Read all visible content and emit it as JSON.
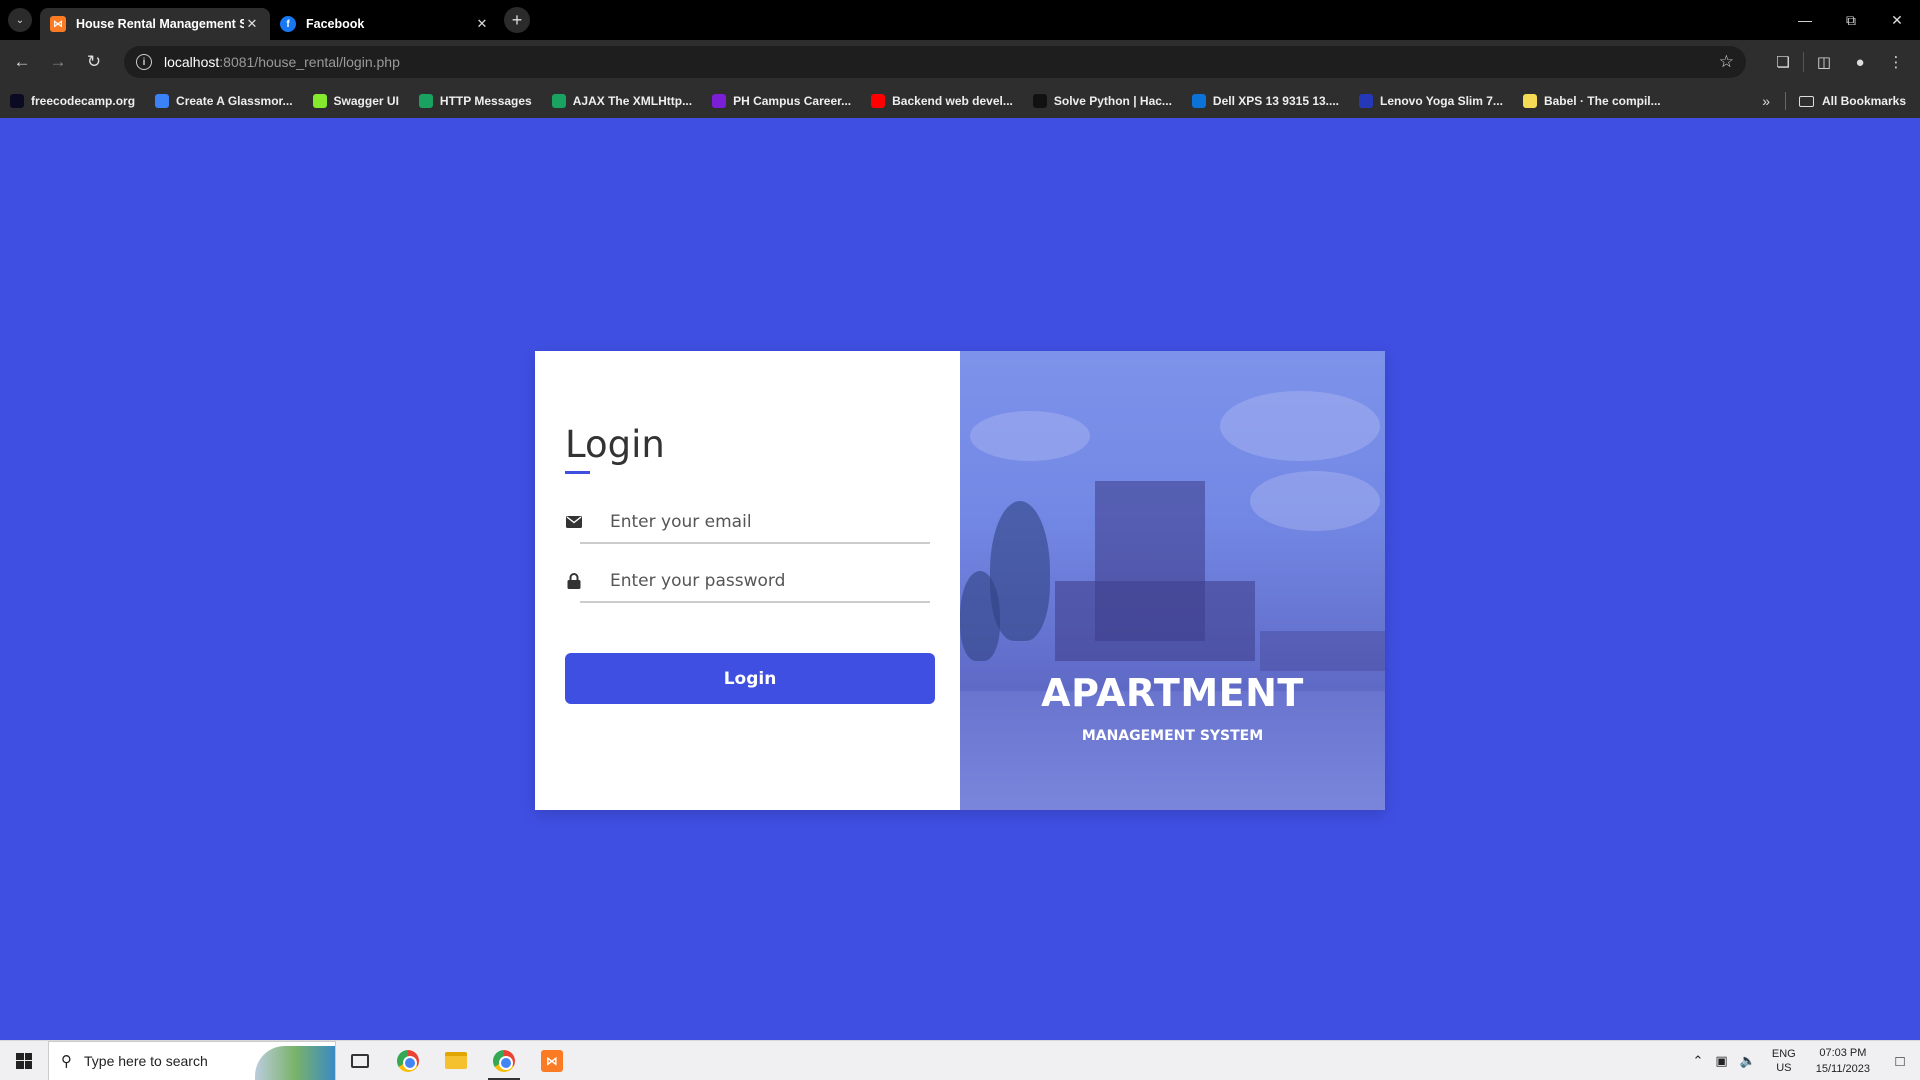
{
  "browser": {
    "tabs": [
      {
        "title": "House Rental Management Sy",
        "favicon": "xampp-icon",
        "active": true
      },
      {
        "title": "Facebook",
        "favicon": "facebook-icon",
        "active": false
      }
    ],
    "url_host": "localhost",
    "url_path": ":8081/house_rental/login.php",
    "bookmarks": [
      {
        "label": "freecodecamp.org",
        "icon": "freecodecamp-icon",
        "color": "#0a0a23"
      },
      {
        "label": "Create A Glassmor...",
        "icon": "glassmorphism-icon",
        "color": "#3b82f6"
      },
      {
        "label": "Swagger UI",
        "icon": "swagger-icon",
        "color": "#85ea2d"
      },
      {
        "label": "HTTP Messages",
        "icon": "mdn-icon",
        "color": "#1aa260"
      },
      {
        "label": "AJAX The XMLHttp...",
        "icon": "w3schools-icon",
        "color": "#1aa260"
      },
      {
        "label": "PH Campus Career...",
        "icon": "ph-icon",
        "color": "#7a1fd6"
      },
      {
        "label": "Backend web devel...",
        "icon": "youtube-icon",
        "color": "#ff0000"
      },
      {
        "label": "Solve Python | Hac...",
        "icon": "hackerrank-icon",
        "color": "#111111"
      },
      {
        "label": "Dell XPS 13 9315 13....",
        "icon": "dell-icon",
        "color": "#0b72d8"
      },
      {
        "label": "Lenovo Yoga Slim 7...",
        "icon": "lenovo-icon",
        "color": "#2438b8"
      },
      {
        "label": "Babel · The compil...",
        "icon": "babel-icon",
        "color": "#f5da55"
      }
    ],
    "all_bookmarks_label": "All Bookmarks"
  },
  "login": {
    "title": "Login",
    "email_placeholder": "Enter your email",
    "password_placeholder": "Enter your password",
    "button_label": "Login",
    "accent_color": "#3f4fe2"
  },
  "hero": {
    "title": "APARTMENT",
    "subtitle": "MANAGEMENT SYSTEM"
  },
  "taskbar": {
    "search_placeholder": "Type here to search",
    "lang_top": "ENG",
    "lang_bottom": "US",
    "time": "07:03 PM",
    "date": "15/11/2023"
  }
}
